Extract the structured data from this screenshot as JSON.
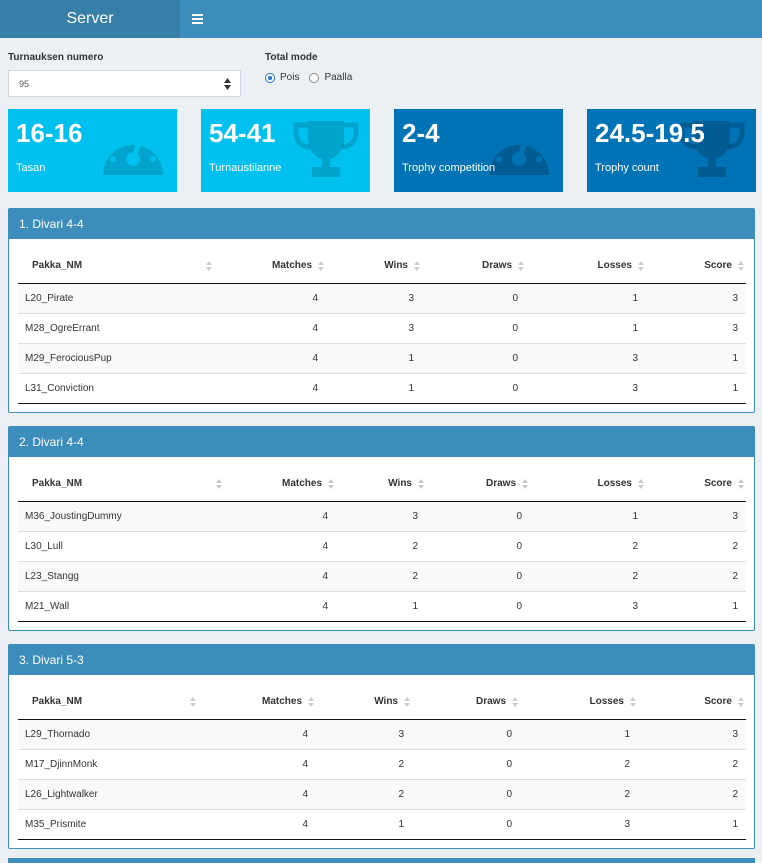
{
  "header": {
    "title": "Server",
    "menu_icon": "bars-icon"
  },
  "controls": {
    "number_label": "Turnauksen numero",
    "number_value": "95",
    "mode_label": "Total mode",
    "mode_options": [
      "Pois",
      "Paalla"
    ],
    "mode_selected": "Pois"
  },
  "value_boxes": [
    {
      "value": "16-16",
      "subtitle": "Tasan",
      "icon": "dashboard-icon",
      "color": "#00c0ef"
    },
    {
      "value": "54-41",
      "subtitle": "Turnaustilanne",
      "icon": "trophy-icon",
      "color": "#00c0ef"
    },
    {
      "value": "2-4",
      "subtitle": "Trophy competition",
      "icon": "dashboard-icon",
      "color": "#0073b7"
    },
    {
      "value": "24.5-19.5",
      "subtitle": "Trophy count",
      "icon": "trophy-icon",
      "color": "#0073b7"
    }
  ],
  "columns": [
    "Pakka_NM",
    "Matches",
    "Wins",
    "Draws",
    "Losses",
    "Score"
  ],
  "panels": [
    {
      "title": "1. Divari 4-4",
      "rows": [
        [
          "L20_Pirate",
          "4",
          "3",
          "0",
          "1",
          "3"
        ],
        [
          "M28_OgreErrant",
          "4",
          "3",
          "0",
          "1",
          "3"
        ],
        [
          "M29_FerociousPup",
          "4",
          "1",
          "0",
          "3",
          "1"
        ],
        [
          "L31_Conviction",
          "4",
          "1",
          "0",
          "3",
          "1"
        ]
      ]
    },
    {
      "title": "2. Divari 4-4",
      "rows": [
        [
          "M36_JoustingDummy",
          "4",
          "3",
          "0",
          "1",
          "3"
        ],
        [
          "L30_Lull",
          "4",
          "2",
          "0",
          "2",
          "2"
        ],
        [
          "L23_Stangg",
          "4",
          "2",
          "0",
          "2",
          "2"
        ],
        [
          "M21_Wall",
          "4",
          "1",
          "0",
          "3",
          "1"
        ]
      ]
    },
    {
      "title": "3. Divari 5-3",
      "rows": [
        [
          "L29_Thornado",
          "4",
          "3",
          "0",
          "1",
          "3"
        ],
        [
          "M17_DjinnMonk",
          "4",
          "2",
          "0",
          "2",
          "2"
        ],
        [
          "L26_Lightwalker",
          "4",
          "2",
          "0",
          "2",
          "2"
        ],
        [
          "M35_Prismite",
          "4",
          "1",
          "0",
          "3",
          "1"
        ]
      ]
    }
  ]
}
